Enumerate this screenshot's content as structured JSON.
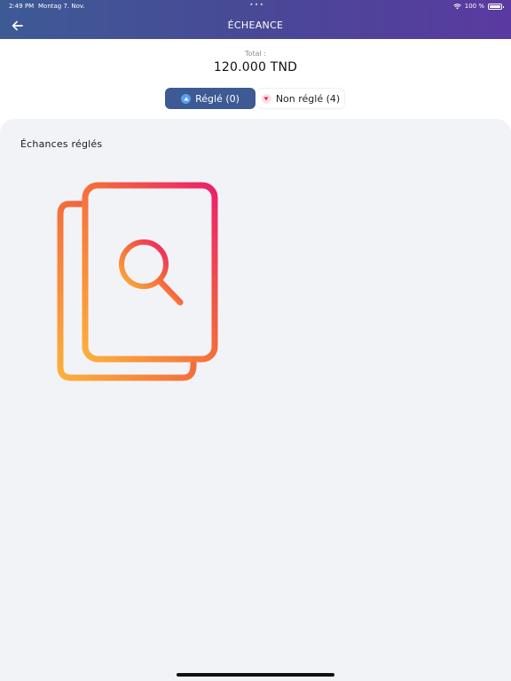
{
  "status_bar": {
    "time": "2:49 PM",
    "date": "Montag 7. Nov.",
    "battery": "100 %"
  },
  "header": {
    "title": "ÉCHEANCE",
    "back_icon": "arrow-left-icon"
  },
  "summary": {
    "total_label": "Total :",
    "total_value": "120.000 TND"
  },
  "tabs": {
    "paid_label": "Réglé (0)",
    "unpaid_label": "Non réglé (4)"
  },
  "section": {
    "title": "Échances réglés"
  },
  "colors": {
    "header_start": "#3d5a95",
    "header_end": "#5a3aa0",
    "active_tab": "#3d5a95",
    "panel_bg": "#f2f3f7",
    "illustration_start": "#fbb03b",
    "illustration_end": "#ec1f6b"
  }
}
